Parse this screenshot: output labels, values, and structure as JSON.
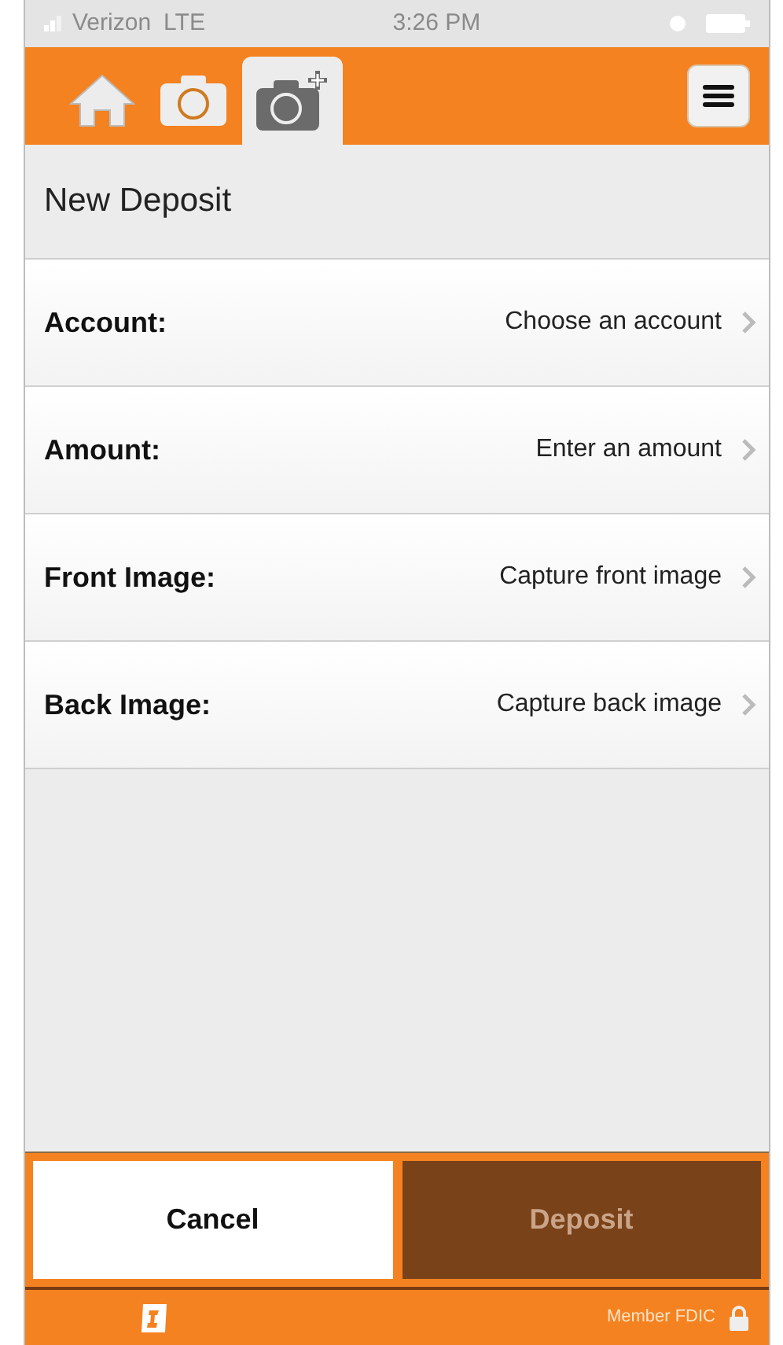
{
  "status_bar": {
    "carrier": "Verizon",
    "network": "LTE",
    "time": "3:26 PM"
  },
  "tabs": [
    {
      "kind": "home",
      "selected": false
    },
    {
      "kind": "camera",
      "selected": false
    },
    {
      "kind": "camera-plus",
      "selected": true
    }
  ],
  "title": "New Deposit",
  "fields": [
    {
      "label": "Account:",
      "value": "Choose an account"
    },
    {
      "label": "Amount:",
      "value": "Enter an amount"
    },
    {
      "label": "Front Image:",
      "value": "Capture front image"
    },
    {
      "label": "Back Image:",
      "value": "Capture back image"
    }
  ],
  "buttons": [
    {
      "label": "Cancel",
      "disabled": false
    },
    {
      "label": "Deposit",
      "disabled": true
    }
  ],
  "footer": {
    "member": "Member FDIC"
  }
}
